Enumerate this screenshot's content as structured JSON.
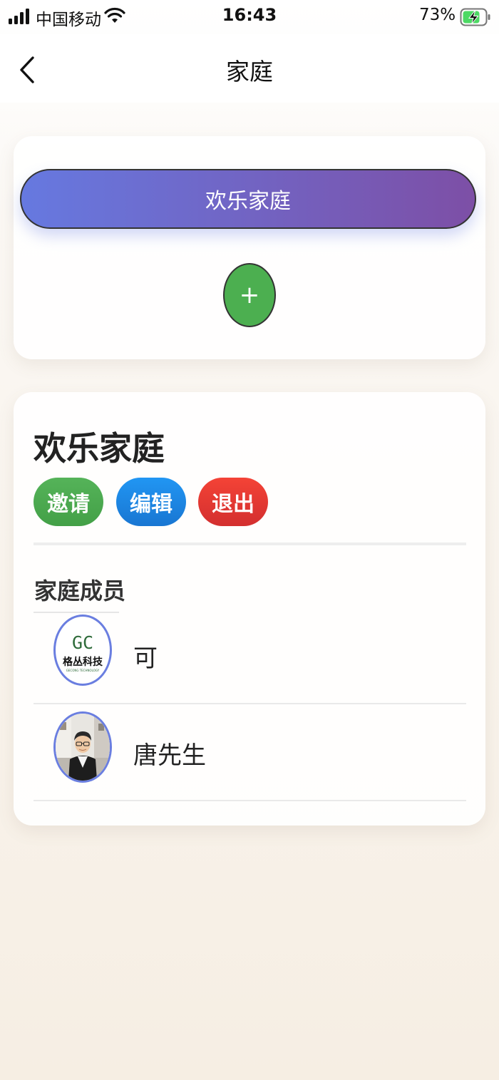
{
  "status_bar": {
    "carrier": "中国移动",
    "time": "16:43",
    "battery_percent": "73%",
    "icons": [
      "signal-icon",
      "wifi-icon",
      "battery-charging-icon"
    ]
  },
  "nav": {
    "title": "家庭",
    "back_icon": "chevron-left-icon"
  },
  "family_selector": {
    "current_family": "欢乐家庭",
    "add_label": "+"
  },
  "family_detail": {
    "name": "欢乐家庭",
    "actions": {
      "invite": "邀请",
      "edit": "编辑",
      "exit": "退出"
    },
    "members_title": "家庭成员",
    "members": [
      {
        "name": "可",
        "avatar_logo_mark": "GC",
        "avatar_logo_text": "格丛科技",
        "avatar_logo_sub": "GECONG TECHNOLOGY"
      },
      {
        "name": "唐先生"
      }
    ]
  },
  "colors": {
    "pill_gradient_start": "#6679e0",
    "pill_gradient_end": "#7d4fa6",
    "add_button": "#4caf50",
    "invite": "#43a047",
    "edit": "#1976d2",
    "exit": "#d32f2f",
    "avatar_border": "#6a7ee0"
  }
}
